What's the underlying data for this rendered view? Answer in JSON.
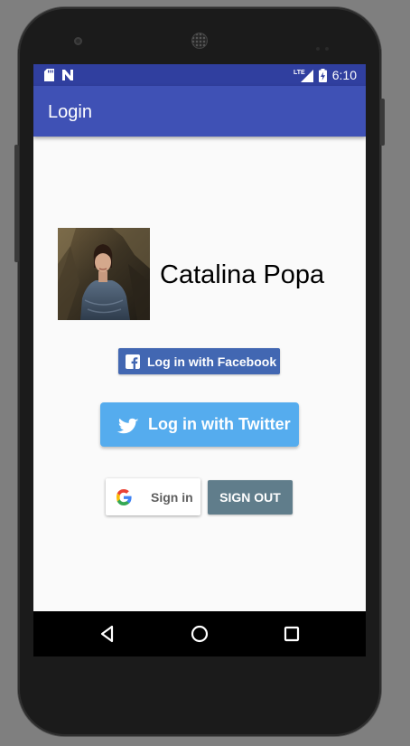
{
  "status_bar": {
    "time": "6:10",
    "network_label": "LTE",
    "icons": [
      "sd-card-icon",
      "n-notification-icon",
      "lte-signal-icon",
      "battery-charging-icon"
    ]
  },
  "app_bar": {
    "title": "Login"
  },
  "profile": {
    "name": "Catalina Popa",
    "photo": "profile-photo"
  },
  "facebook_button": {
    "label": "Log in with Facebook",
    "icon": "facebook-icon",
    "color": "#4267b2"
  },
  "twitter_button": {
    "label": "Log in with Twitter",
    "icon": "twitter-bird-icon",
    "color": "#55acee"
  },
  "google_button": {
    "label": "Sign in",
    "icon": "google-g-icon"
  },
  "signout_button": {
    "label": "SIGN OUT",
    "color": "#607d8b"
  },
  "nav_bar": {
    "icons": [
      "back-icon",
      "home-icon",
      "recents-icon"
    ]
  },
  "theme": {
    "primary": "#3f51b5",
    "primary_dark": "#303f9f",
    "background": "#fafafa"
  }
}
